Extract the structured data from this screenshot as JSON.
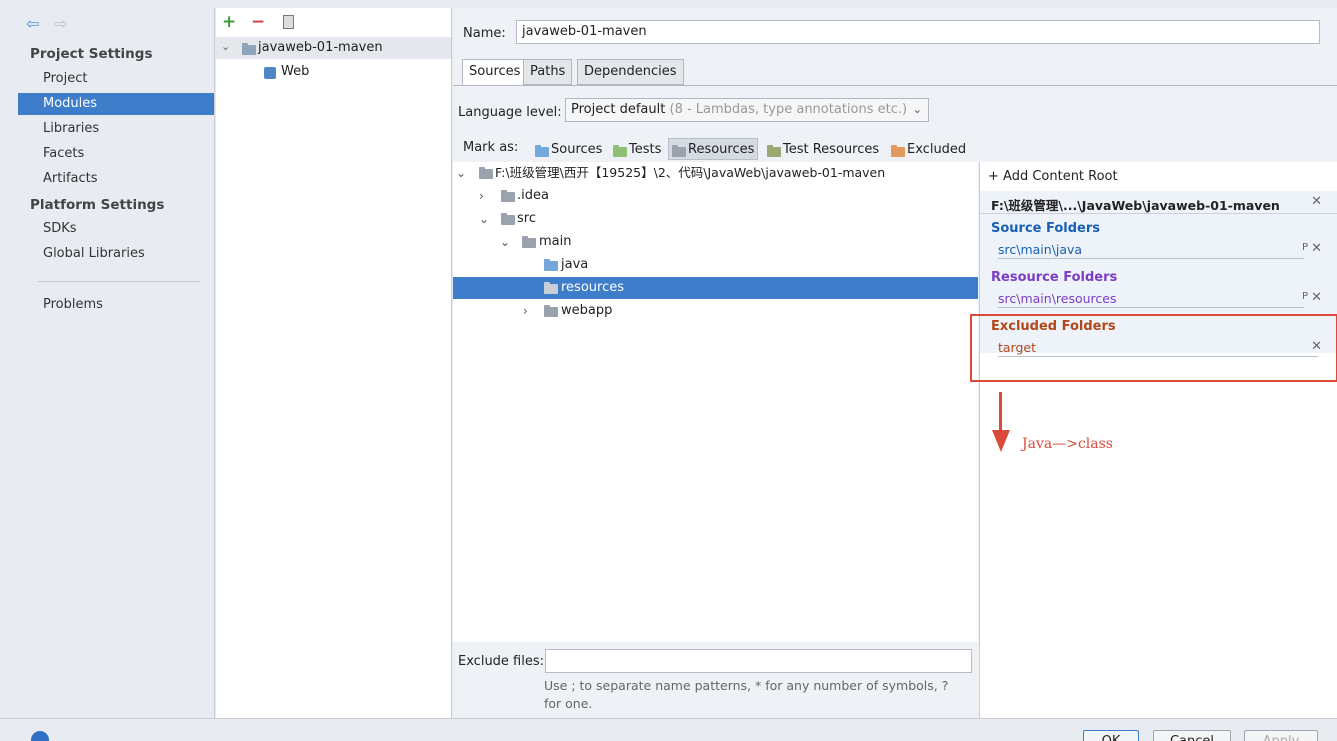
{
  "nav": {
    "project_settings": "Project Settings",
    "items1": [
      "Project",
      "Modules",
      "Libraries",
      "Facets",
      "Artifacts"
    ],
    "platform_settings": "Platform Settings",
    "items2": [
      "SDKs",
      "Global Libraries"
    ],
    "problems": "Problems"
  },
  "modules": {
    "root": "javaweb-01-maven",
    "child": "Web"
  },
  "main": {
    "name_label": "Name:",
    "name_value": "javaweb-01-maven",
    "tabs": [
      "Sources",
      "Paths",
      "Dependencies"
    ],
    "language_level_label": "Language level:",
    "language_level_value": "Project default",
    "language_level_hint": "(8 - Lambdas, type annotations etc.)",
    "mark_as_label": "Mark as:",
    "mark_buttons": [
      "Sources",
      "Tests",
      "Resources",
      "Test Resources",
      "Excluded"
    ],
    "exclude_files_label": "Exclude files:",
    "exclude_files_value": "",
    "exclude_hint_1": "Use ; to separate name patterns, * for any number of symbols, ?",
    "exclude_hint_2": "for one."
  },
  "tree": {
    "root": "F:\\班级管理\\西开【19525】\\2、代码\\JavaWeb\\javaweb-01-maven",
    "idea": ".idea",
    "src": "src",
    "main": "main",
    "java": "java",
    "resources": "resources",
    "webapp": "webapp"
  },
  "content_root": {
    "add_label": "+ Add Content Root",
    "path": "F:\\班级管理\\...\\JavaWeb\\javaweb-01-maven",
    "source_title": "Source Folders",
    "source_path": "src\\main\\java",
    "resource_title": "Resource Folders",
    "resource_path": "src\\main\\resources",
    "excluded_title": "Excluded Folders",
    "excluded_path": "target",
    "note": "Java—>class"
  },
  "buttons": {
    "ok": "OK",
    "cancel": "Cancel",
    "apply": "Apply"
  },
  "colors": {
    "accent": "#3d7dca",
    "source": "#1a5fb4",
    "resource": "#7a3dc4",
    "excluded": "#b1481a",
    "annotation": "#d94a3a"
  }
}
